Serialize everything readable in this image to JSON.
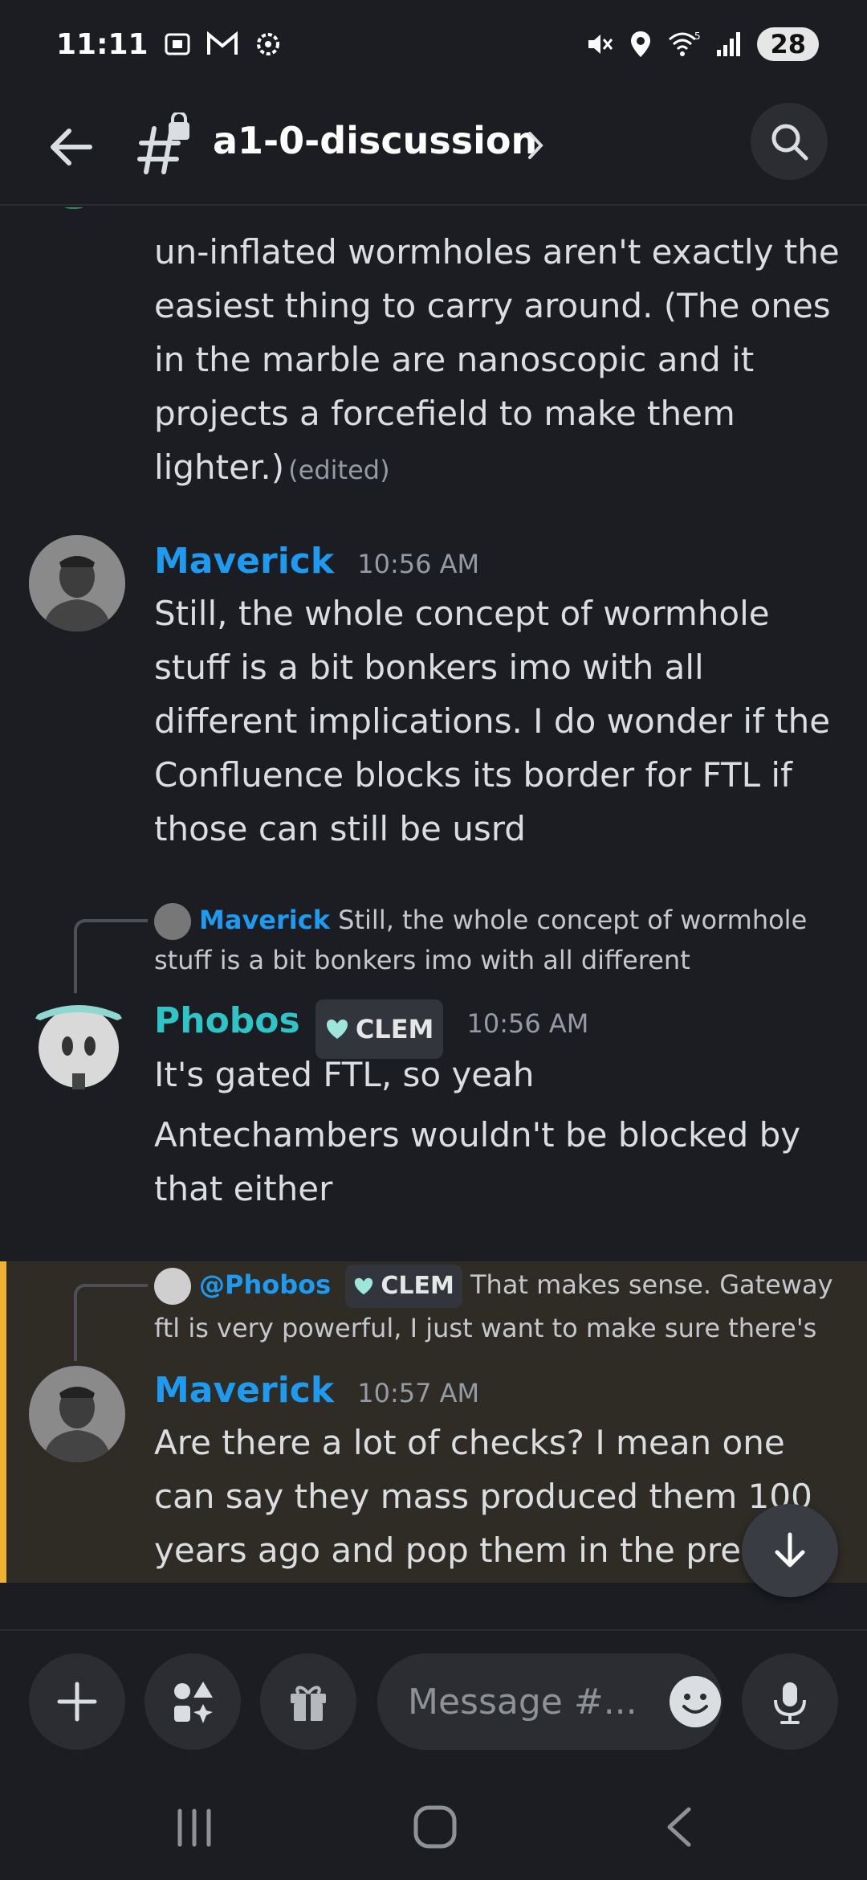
{
  "status_bar": {
    "time": "11:11",
    "battery": "28",
    "icons": [
      "screenshot-icon",
      "gmail-icon",
      "settings-icon",
      "mute-icon",
      "location-icon",
      "wifi-icon",
      "signal-icon"
    ]
  },
  "header": {
    "channel_name": "a1-0-discussion"
  },
  "messages": [
    {
      "text": "un-inflated wormholes aren't exactly the\neasiest thing to carry around. (The ones\nin the marble are nanoscopic and it\nprojects a forcefield to make them\nlighter.)",
      "edited_label": "(edited)"
    },
    {
      "author": "Maverick",
      "author_color": "#1e9bf0",
      "time": "10:56 AM",
      "text": "Still, the whole concept of wormhole\nstuff is a bit bonkers imo with all\ndifferent implications. I do wonder if the\nConfluence blocks its border for FTL if\nthose can still be usrd"
    },
    {
      "reply": {
        "author": "Maverick",
        "text_line1": "Still, the whole concept of wormhole",
        "text_line2": "stuff is a bit bonkers imo with all different"
      },
      "author": "Phobos",
      "author_color": "#2fc5c7",
      "tag": "CLEM",
      "time": "10:56 AM",
      "text": "It's gated FTL, so yeah",
      "text2": "Antechambers wouldn't be blocked by\nthat either"
    },
    {
      "reply": {
        "author": "@Phobos",
        "tag": "CLEM",
        "text_line1": "That makes sense. Gateway",
        "text_line2": "ftl is very powerful, I just want to make sure there's"
      },
      "author": "Maverick",
      "author_color": "#1e9bf0",
      "time": "10:57 AM",
      "text": "Are there a lot of checks? I mean one\ncan say they mass produced them 100\nyears ago and pop them in the prese"
    }
  ],
  "composer": {
    "placeholder": "Message #..."
  },
  "colors": {
    "background": "#1c1d22",
    "mention_highlight": "#2f2c25",
    "mention_bar": "#f0b232"
  }
}
